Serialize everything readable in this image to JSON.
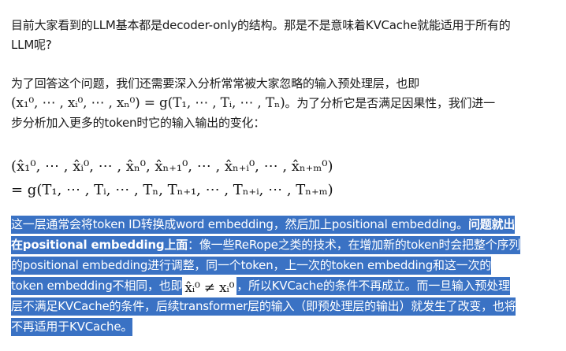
{
  "p1": {
    "line1": "目前大家看到的LLM基本都是decoder-only的结构。那是不是意味着KVCache就能适用于所有的",
    "line2": "LLM呢?"
  },
  "p2": {
    "line1": "为了回答这个问题，我们还需要深入分析常常被大家忽略的输入预处理层，也即",
    "formula": "(x₁⁰, ⋯ , xᵢ⁰, ⋯ , xₙ⁰) = g(T₁, ⋯ , Tᵢ, ⋯ , Tₙ)",
    "line2_rest": "。为了分析它是否满足因果性，我们进一",
    "line3": "步分析加入更多的token时它的输入输出的变化："
  },
  "equation": {
    "line1": "(x̂₁⁰, ⋯ , x̂ᵢ⁰, ⋯ , x̂ₙ⁰, x̂ₙ₊₁⁰, ⋯ , x̂ₙ₊ᵢ⁰, ⋯ , x̂ₙ₊ₘ⁰)",
    "line2": "= g(T₁, ⋯ , Tᵢ, ⋯ , Tₙ, Tₙ₊₁, ⋯ , Tₙ₊ᵢ, ⋯ , Tₙ₊ₘ)"
  },
  "p3": {
    "l1a": "这一层通常会将token ID转换成word embedding，然后加上positional embedding。",
    "l1b": "问题就出",
    "l2a": "在positional embedding上面",
    "l2b": "：像一些ReRope之类的技术，在增加新的token时会把整个序列",
    "l3": "的positional embedding进行调整，同一个token，上一次的token embedding和这一次的",
    "l4a": "token embedding不相同，也即",
    "inline_formula": "x̂ᵢ⁰ ≠ xᵢ⁰",
    "l4b": "，所以KVCache的条件不再成立。而一旦输入预处理",
    "l5": "层不满足KVCache的条件，后续transformer层的输入（即预处理层的输出）就发生了改变，也将",
    "l6": "不再适用于KVCache。"
  }
}
